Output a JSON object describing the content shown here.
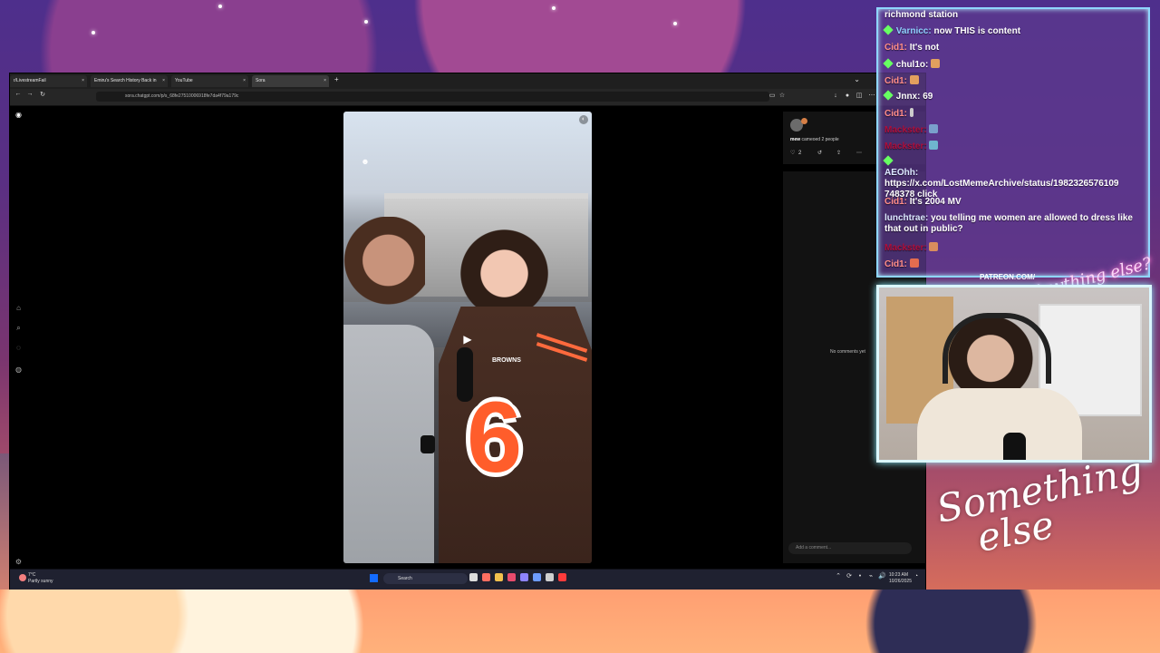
{
  "browser": {
    "tabs": [
      {
        "label": "r/LivestreamFail"
      },
      {
        "label": "Emiru's Search History Back in"
      },
      {
        "label": "YouTube"
      },
      {
        "label": "Sora",
        "active": true
      }
    ],
    "address": "sora.chatgpt.com/p/s_68fe27510006918fe7da4f79a179c"
  },
  "sora": {
    "meta_user": "mew",
    "meta_text": "cameoed 2 people",
    "likes": "2",
    "no_comments": "No comments yet",
    "comment_placeholder": "Add a comment..."
  },
  "taskbar": {
    "weather_temp": "7°C",
    "weather_desc": "Partly sunny",
    "search": "Search",
    "time": "10:23 AM",
    "date": "10/26/2025"
  },
  "chat": {
    "top_fragment": "richmond station",
    "lines": [
      {
        "user": "Varnicc:",
        "msg": "now THIS is content"
      },
      {
        "user": "Cid1:",
        "msg": "It's not"
      },
      {
        "user": "chul1o:",
        "msg": ""
      },
      {
        "user": "Cid1:",
        "msg": ""
      },
      {
        "user": "Jnnx:",
        "msg": "69"
      },
      {
        "user": "Cid1:",
        "msg": ""
      },
      {
        "user": "Mackster:",
        "msg": ""
      },
      {
        "user": "Mackster:",
        "msg": ""
      },
      {
        "user": "AEOhh:",
        "msg": "https://x.com/LostMemeArchive/status/1982326576109 748378 click"
      },
      {
        "user": "Cid1:",
        "msg": "It's 2004 MV"
      },
      {
        "user": "lunchtrae:",
        "msg": "you telling me women are allowed to dress like that out in public?"
      },
      {
        "user": "Mackster:",
        "msg": ""
      },
      {
        "user": "Cid1:",
        "msg": ""
      }
    ]
  },
  "overlay": {
    "patreon": "PATREON.COM/",
    "logo_small": "Anything else?",
    "logo_big_1": "Something",
    "logo_big_2": "else"
  },
  "video_text": {
    "jersey_brand": "BROWNS",
    "jersey_number": "6"
  }
}
